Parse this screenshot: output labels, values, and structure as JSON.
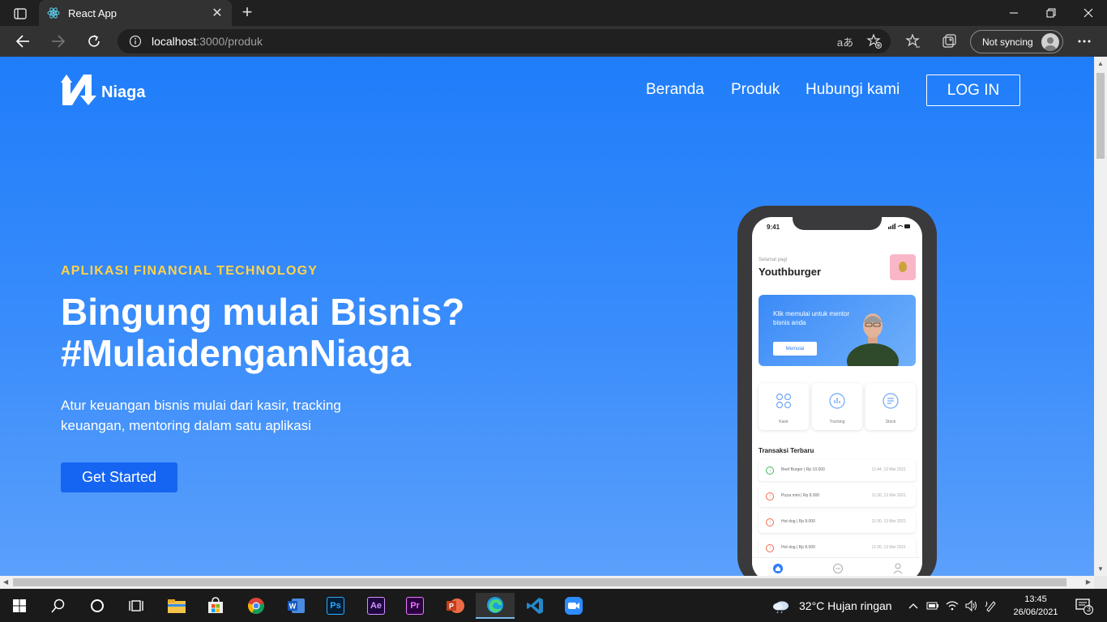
{
  "browser": {
    "tab_title": "React App",
    "tab_close": "✕",
    "new_tab": "+",
    "url_host": "localhost",
    "url_path": ":3000/produk",
    "read_aloud": "aあ",
    "sync_label": "Not syncing"
  },
  "site": {
    "logo_text": "Niaga",
    "nav": [
      "Beranda",
      "Produk",
      "Hubungi kami"
    ],
    "login_label": "LOG IN",
    "eyebrow": "APLIKASI FINANCIAL TECHNOLOGY",
    "headline_line1": "Bingung mulai Bisnis?",
    "headline_line2": "#MulaidenganNiaga",
    "subtext": "Atur keuangan bisnis mulai dari kasir, tracking keuangan, mentoring dalam satu aplikasi",
    "cta_label": "Get Started"
  },
  "phone": {
    "time": "9:41",
    "greeting": "Selamat pagi",
    "store_name": "Youthburger",
    "banner_text": "Klik memulai untuk mentor bisnis anda",
    "banner_button": "Memulai",
    "tiles": [
      "Kasir",
      "Tracking",
      "Stock"
    ],
    "tx_title": "Transaksi Terbaru",
    "transactions": [
      {
        "name": "Beef Burger | Rp 10.000",
        "date": "11:44, 13 Mei 2021",
        "type": "in"
      },
      {
        "name": "Pizza mini | Rp 8.000",
        "date": "11:30, 13 Mei 2021",
        "type": "out"
      },
      {
        "name": "Hot dog | Rp 8.000",
        "date": "11:30, 13 Mei 2021",
        "type": "out"
      },
      {
        "name": "Hot dog | Rp 8.000",
        "date": "11:30, 13 Mei 2021",
        "type": "out"
      }
    ]
  },
  "taskbar": {
    "weather": "32°C  Hujan ringan",
    "time": "13:45",
    "date": "26/06/2021",
    "notifications": "3",
    "apps": [
      "Ps",
      "Ae",
      "Pr"
    ]
  },
  "colors": {
    "page_bg": "#1f7dfa",
    "accent_yellow": "#ffd24a",
    "cta_blue": "#1565f2"
  }
}
